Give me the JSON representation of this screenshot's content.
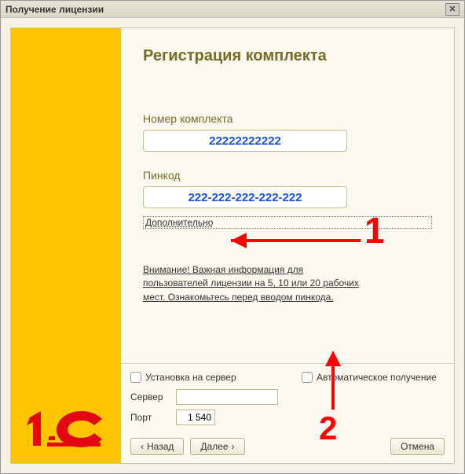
{
  "window": {
    "title": "Получение лицензии"
  },
  "heading": "Регистрация комплекта",
  "fields": {
    "kit_label": "Номер комплекта",
    "kit_value": "22222222222",
    "pin_label": "Пинкод",
    "pin_value": "222-222-222-222-222"
  },
  "links": {
    "additional": "Дополнительно",
    "warning": "Внимание! Важная информация для пользователей лицензии на 5, 10 или 20 рабочих мест. Ознакомьтесь перед вводом пинкода."
  },
  "options": {
    "install_server": "Установка на сервер",
    "server_label": "Сервер",
    "server_value": "",
    "port_label": "Порт",
    "port_value": "1 540",
    "auto_get": "Автоматическое получение"
  },
  "buttons": {
    "back": "Назад",
    "next": "Далее",
    "cancel": "Отмена"
  },
  "annotations": {
    "n1": "1",
    "n2": "2"
  }
}
